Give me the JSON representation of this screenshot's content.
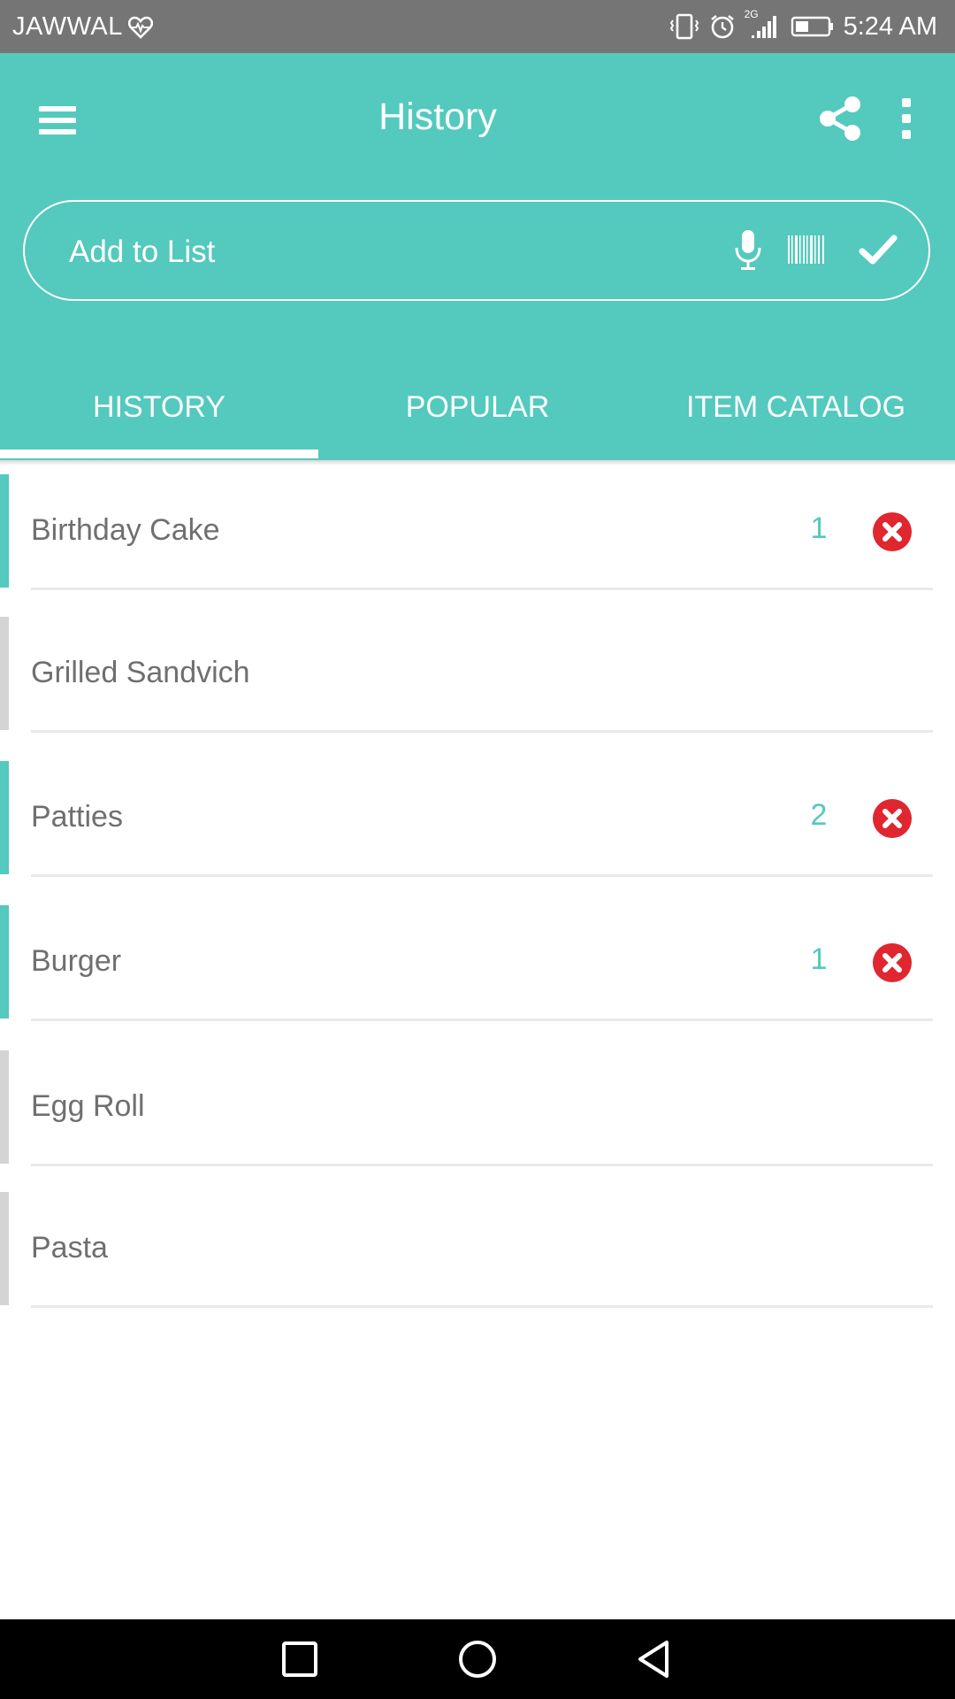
{
  "status_bar": {
    "carrier": "JAWWAL",
    "network": "2G",
    "time": "5:24 AM",
    "icons": [
      "heart-monitor-icon",
      "vibrate-icon",
      "alarm-icon",
      "signal-icon",
      "battery-icon"
    ]
  },
  "header": {
    "title": "History",
    "icons": [
      "menu-icon",
      "share-icon",
      "more-vert-icon"
    ]
  },
  "add_box": {
    "placeholder": "Add to List",
    "icons": [
      "microphone-icon",
      "barcode-icon",
      "check-icon"
    ]
  },
  "tabs": [
    {
      "label": "HISTORY",
      "active": true
    },
    {
      "label": "POPULAR",
      "active": false
    },
    {
      "label": "ITEM CATALOG",
      "active": false
    }
  ],
  "items": [
    {
      "name": "Birthday Cake",
      "qty": "1",
      "in_list": true
    },
    {
      "name": "Grilled Sandvich",
      "qty": "",
      "in_list": false
    },
    {
      "name": "Patties",
      "qty": "2",
      "in_list": true
    },
    {
      "name": "Burger",
      "qty": "1",
      "in_list": true
    },
    {
      "name": "Egg Roll",
      "qty": "",
      "in_list": false
    },
    {
      "name": "Pasta",
      "qty": "",
      "in_list": false
    }
  ],
  "colors": {
    "accent": "#54c9be",
    "inactive_bar": "#d4d4d4",
    "remove": "#e0262f",
    "status_bar": "#757575"
  },
  "nav_icons": [
    "recents-icon",
    "home-icon",
    "back-icon"
  ]
}
